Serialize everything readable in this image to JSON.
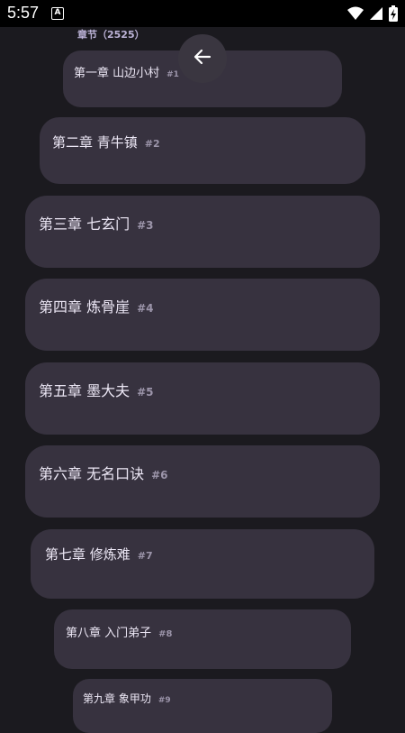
{
  "status_bar": {
    "time": "5:57",
    "app_icon_letter": "A",
    "icons": [
      "wifi-icon",
      "signal-icon",
      "battery-charging-icon"
    ]
  },
  "header": {
    "chapters_label": "章节（2525）",
    "back_icon": "arrow-left-icon"
  },
  "chapters": [
    {
      "title": "第一章 山边小村",
      "num": "#1"
    },
    {
      "title": "第二章 青牛镇",
      "num": "#2"
    },
    {
      "title": "第三章 七玄门",
      "num": "#3"
    },
    {
      "title": "第四章 炼骨崖",
      "num": "#4"
    },
    {
      "title": "第五章 墨大夫",
      "num": "#5"
    },
    {
      "title": "第六章 无名口诀",
      "num": "#6"
    },
    {
      "title": "第七章 修炼难",
      "num": "#7"
    },
    {
      "title": "第八章 入门弟子",
      "num": "#8"
    },
    {
      "title": "第九章 象甲功",
      "num": "#9"
    }
  ]
}
